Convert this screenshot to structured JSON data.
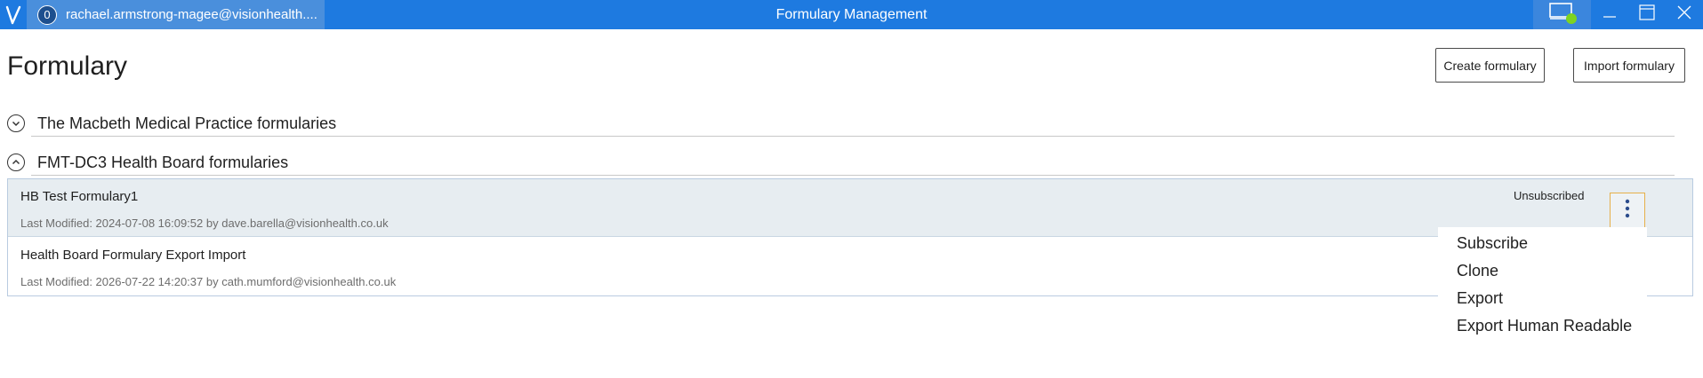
{
  "titlebar": {
    "logo": "vision-logo",
    "user_badge": "0",
    "user_email": "rachael.armstrong-magee@visionhealth....",
    "title": "Formulary Management",
    "status_icon": "monitor-icon",
    "status_color": "#7ed321",
    "controls": [
      "minimize-icon",
      "maximize-icon",
      "close-icon"
    ]
  },
  "page": {
    "title": "Formulary",
    "create_button": "Create formulary",
    "import_button": "Import formulary"
  },
  "groups": [
    {
      "label": "The Macbeth Medical Practice formularies",
      "expanded": false
    },
    {
      "label": "FMT-DC3 Health Board formularies",
      "expanded": true,
      "items": [
        {
          "name": "HB Test Formulary1",
          "meta": "Last Modified: 2024-07-08 16:09:52 by dave.barella@visionhealth.co.uk",
          "status": "Unsubscribed",
          "selected": true
        },
        {
          "name": "Health Board Formulary Export Import",
          "meta": "Last Modified: 2026-07-22 14:20:37 by cath.mumford@visionhealth.co.uk",
          "status": "",
          "selected": false
        }
      ]
    }
  ],
  "context_menu": {
    "items": [
      "Subscribe",
      "Clone",
      "Export",
      "Export Human Readable"
    ]
  },
  "colors": {
    "titlebar": "#1e7ae0",
    "selected_row": "#e7edf1",
    "kebab_border": "#e6b04a",
    "kebab_dots": "#2b4c8c"
  }
}
